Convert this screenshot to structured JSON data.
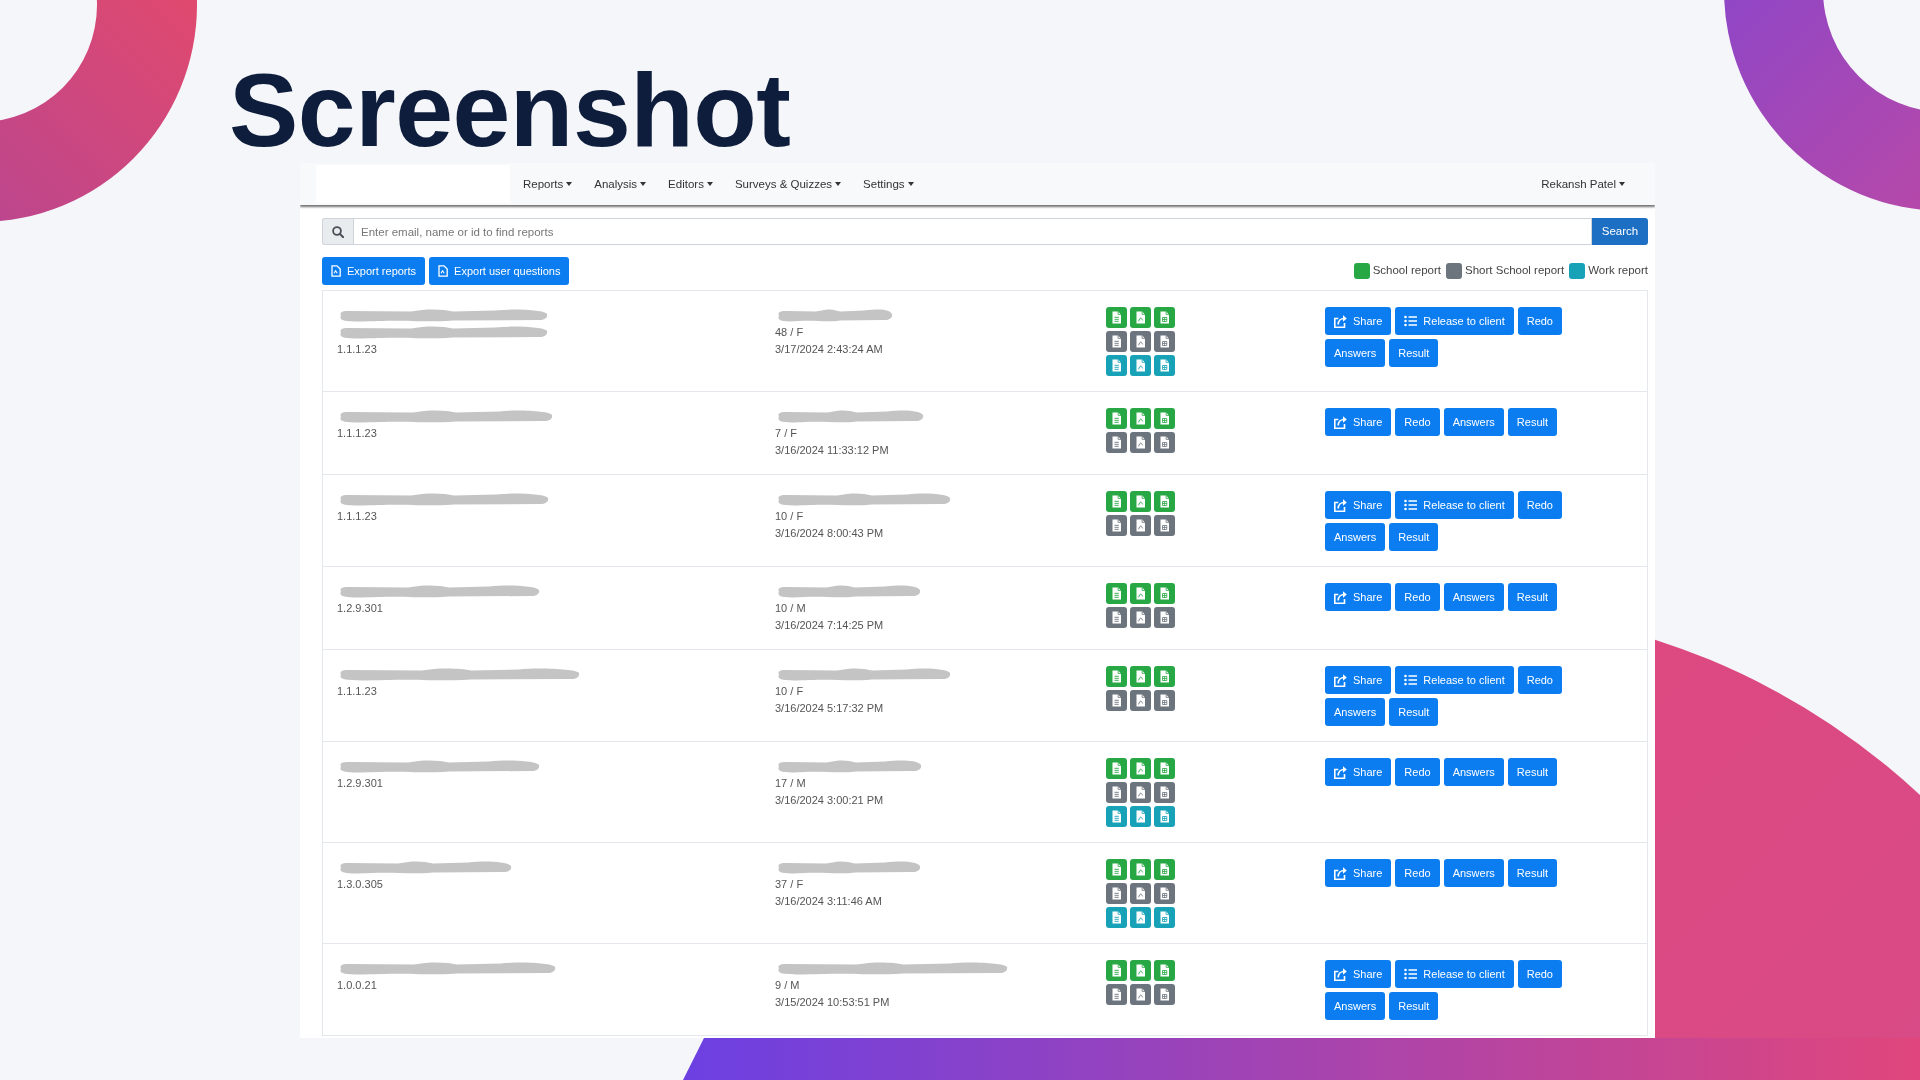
{
  "slide": {
    "title": "Screenshot"
  },
  "navbar": {
    "menus": [
      "Reports",
      "Analysis",
      "Editors",
      "Surveys & Quizzes",
      "Settings"
    ],
    "user": "Rekansh Patel"
  },
  "search": {
    "placeholder": "Enter email, name or id to find reports",
    "button": "Search"
  },
  "toolbar": {
    "buttons": [
      "Export reports",
      "Export user questions"
    ]
  },
  "legend": [
    {
      "label": "School report",
      "color": "#28a745"
    },
    {
      "label": "Short School report",
      "color": "#6c757d"
    },
    {
      "label": "Work report",
      "color": "#17a2b8"
    }
  ],
  "rows": [
    {
      "name_lines": [
        {
          "redacted": true
        },
        {
          "redacted": true
        }
      ],
      "version": "1.1.1.23",
      "user_lines": [
        {
          "redacted": true
        }
      ],
      "age_gender": "48 / F",
      "date": "3/17/2024 2:43:24 AM",
      "reports": [
        {
          "color": "#28a745"
        },
        {
          "color": "#6c757d"
        },
        {
          "color": "#17a2b8"
        }
      ],
      "actions": [
        {
          "label": "Share",
          "kind": "share"
        },
        {
          "label": "Release to client",
          "kind": "release"
        },
        {
          "label": "Redo",
          "kind": "plain"
        },
        {
          "label": "Answers",
          "kind": "plain"
        },
        {
          "label": "Result",
          "kind": "plain"
        }
      ]
    },
    {
      "name_lines": [
        {
          "redacted": true
        }
      ],
      "version": "1.1.1.23",
      "user_lines": [
        {
          "redacted": true
        }
      ],
      "age_gender": "7 / F",
      "date": "3/16/2024 11:33:12 PM",
      "reports": [
        {
          "color": "#28a745"
        },
        {
          "color": "#6c757d"
        }
      ],
      "actions": [
        {
          "label": "Share",
          "kind": "share"
        },
        {
          "label": "Redo",
          "kind": "plain"
        },
        {
          "label": "Answers",
          "kind": "plain"
        },
        {
          "label": "Result",
          "kind": "plain"
        }
      ]
    },
    {
      "name_lines": [
        {
          "redacted": true
        }
      ],
      "version": "1.1.1.23",
      "user_lines": [
        {
          "redacted": true
        }
      ],
      "age_gender": "10 / F",
      "date": "3/16/2024 8:00:43 PM",
      "reports": [
        {
          "color": "#28a745"
        },
        {
          "color": "#6c757d"
        }
      ],
      "actions": [
        {
          "label": "Share",
          "kind": "share"
        },
        {
          "label": "Release to client",
          "kind": "release"
        },
        {
          "label": "Redo",
          "kind": "plain"
        },
        {
          "label": "Answers",
          "kind": "plain"
        },
        {
          "label": "Result",
          "kind": "plain"
        }
      ]
    },
    {
      "name_lines": [
        {
          "redacted": true
        }
      ],
      "version": "1.2.9.301",
      "user_lines": [
        {
          "redacted": true
        }
      ],
      "age_gender": "10 / M",
      "date": "3/16/2024 7:14:25 PM",
      "reports": [
        {
          "color": "#28a745"
        },
        {
          "color": "#6c757d"
        }
      ],
      "actions": [
        {
          "label": "Share",
          "kind": "share"
        },
        {
          "label": "Redo",
          "kind": "plain"
        },
        {
          "label": "Answers",
          "kind": "plain"
        },
        {
          "label": "Result",
          "kind": "plain"
        }
      ]
    },
    {
      "name_lines": [
        {
          "redacted": true
        }
      ],
      "version": "1.1.1.23",
      "user_lines": [
        {
          "redacted": true
        }
      ],
      "age_gender": "10 / F",
      "date": "3/16/2024 5:17:32 PM",
      "reports": [
        {
          "color": "#28a745"
        },
        {
          "color": "#6c757d"
        }
      ],
      "actions": [
        {
          "label": "Share",
          "kind": "share"
        },
        {
          "label": "Release to client",
          "kind": "release"
        },
        {
          "label": "Redo",
          "kind": "plain"
        },
        {
          "label": "Answers",
          "kind": "plain"
        },
        {
          "label": "Result",
          "kind": "plain"
        }
      ]
    },
    {
      "name_lines": [
        {
          "redacted": true
        }
      ],
      "version": "1.2.9.301",
      "user_lines": [
        {
          "redacted": true
        }
      ],
      "age_gender": "17 / M",
      "date": "3/16/2024 3:00:21 PM",
      "reports": [
        {
          "color": "#28a745"
        },
        {
          "color": "#6c757d"
        },
        {
          "color": "#17a2b8"
        }
      ],
      "actions": [
        {
          "label": "Share",
          "kind": "share"
        },
        {
          "label": "Redo",
          "kind": "plain"
        },
        {
          "label": "Answers",
          "kind": "plain"
        },
        {
          "label": "Result",
          "kind": "plain"
        }
      ]
    },
    {
      "name_lines": [
        {
          "redacted": true
        }
      ],
      "version": "1.3.0.305",
      "user_lines": [
        {
          "redacted": true
        }
      ],
      "age_gender": "37 / F",
      "date": "3/16/2024 3:11:46 AM",
      "reports": [
        {
          "color": "#28a745"
        },
        {
          "color": "#6c757d"
        },
        {
          "color": "#17a2b8"
        }
      ],
      "actions": [
        {
          "label": "Share",
          "kind": "share"
        },
        {
          "label": "Redo",
          "kind": "plain"
        },
        {
          "label": "Answers",
          "kind": "plain"
        },
        {
          "label": "Result",
          "kind": "plain"
        }
      ]
    },
    {
      "name_lines": [
        {
          "redacted": true
        }
      ],
      "version": "1.0.0.21",
      "user_lines": [
        {
          "redacted": true
        }
      ],
      "age_gender": "9 / M",
      "date": "3/15/2024 10:53:51 PM",
      "reports": [
        {
          "color": "#28a745"
        },
        {
          "color": "#6c757d"
        }
      ],
      "actions": [
        {
          "label": "Share",
          "kind": "share"
        },
        {
          "label": "Release to client",
          "kind": "release"
        },
        {
          "label": "Redo",
          "kind": "plain"
        },
        {
          "label": "Answers",
          "kind": "plain"
        },
        {
          "label": "Result",
          "kind": "plain"
        }
      ]
    }
  ]
}
